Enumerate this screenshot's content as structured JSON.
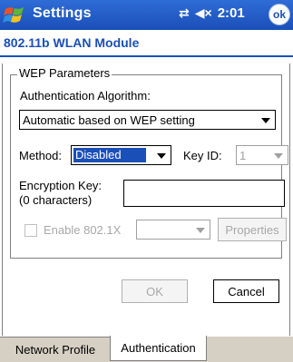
{
  "titlebar": {
    "app_title": "Settings",
    "connectivity_icon": "connectivity-icon",
    "volume_icon": "speaker-muted-icon",
    "time": "2:01",
    "ok_label": "ok"
  },
  "page": {
    "subtitle": "802.11b WLAN Module"
  },
  "wep": {
    "legend": "WEP Parameters",
    "auth_label": "Authentication Algorithm:",
    "auth_value": "Automatic based on WEP setting",
    "method_label": "Method:",
    "method_value": "Disabled",
    "keyid_label": "Key ID:",
    "keyid_value": "1",
    "key_label_line1": "Encryption Key:",
    "key_label_line2": "(0 characters)",
    "key_value": "",
    "enable_8021x_label": "Enable 802.1X",
    "eap_value": "",
    "properties_label": "Properties"
  },
  "actions": {
    "ok_label": "OK",
    "cancel_label": "Cancel"
  },
  "tabs": [
    {
      "label": "Network Profile",
      "active": false
    },
    {
      "label": "Authentication",
      "active": true
    }
  ],
  "colors": {
    "titlebar": "#1b4fb8",
    "selection": "#1b4fb8",
    "tabstrip": "#d6cfc3"
  }
}
